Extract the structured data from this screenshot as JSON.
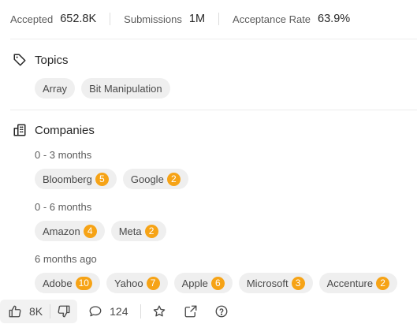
{
  "stats": [
    {
      "label": "Accepted",
      "value": "652.8K"
    },
    {
      "label": "Submissions",
      "value": "1M"
    },
    {
      "label": "Acceptance Rate",
      "value": "63.9%"
    }
  ],
  "topics": {
    "title": "Topics",
    "icon": "tag-icon",
    "tags": [
      "Array",
      "Bit Manipulation"
    ]
  },
  "companies": {
    "title": "Companies",
    "icon": "building-icon",
    "groups": [
      {
        "label": "0 - 3 months",
        "items": [
          {
            "name": "Bloomberg",
            "count": "5"
          },
          {
            "name": "Google",
            "count": "2"
          }
        ]
      },
      {
        "label": "0 - 6 months",
        "items": [
          {
            "name": "Amazon",
            "count": "4"
          },
          {
            "name": "Meta",
            "count": "2"
          }
        ]
      },
      {
        "label": "6 months ago",
        "items": [
          {
            "name": "Adobe",
            "count": "10"
          },
          {
            "name": "Yahoo",
            "count": "7"
          },
          {
            "name": "Apple",
            "count": "6"
          },
          {
            "name": "Microsoft",
            "count": "3"
          },
          {
            "name": "Accenture",
            "count": "2"
          }
        ]
      }
    ]
  },
  "footer": {
    "likes": "8K",
    "comments": "124",
    "icons": [
      "thumbs-up-icon",
      "thumbs-down-icon",
      "comment-icon",
      "star-icon",
      "share-icon",
      "help-icon"
    ]
  },
  "colors": {
    "badge": "#f6a316",
    "chip": "#efefef"
  }
}
